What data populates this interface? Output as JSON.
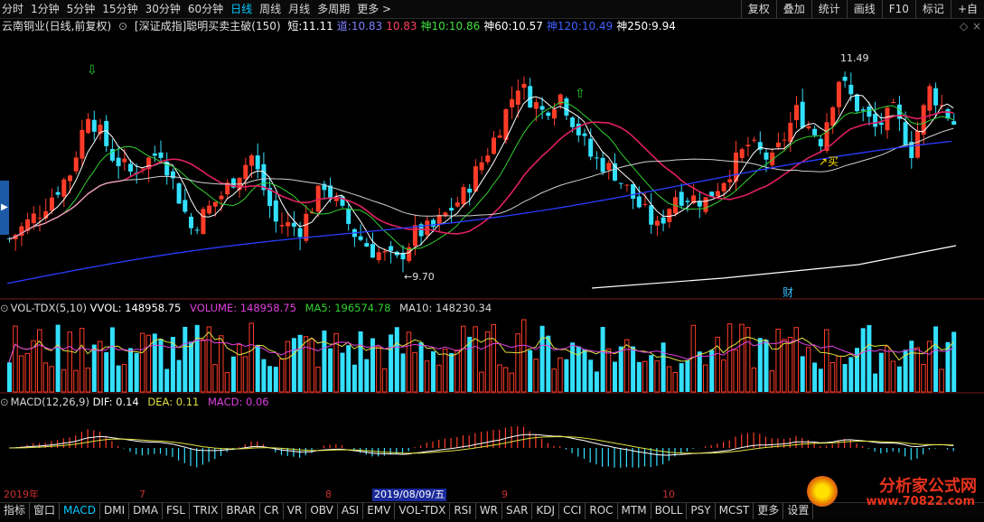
{
  "toolbar": {
    "periods": [
      "分时",
      "1分钟",
      "5分钟",
      "15分钟",
      "30分钟",
      "60分钟",
      "日线",
      "周线",
      "月线",
      "多周期",
      "更多 >"
    ],
    "active_period": "日线",
    "right_buttons": [
      "复权",
      "叠加",
      "统计",
      "画线",
      "F10",
      "标记",
      "+自"
    ]
  },
  "info": {
    "stock": "云南铜业(日线,前复权)",
    "indicator": "[深证成指]聪明买卖主破(150)",
    "items": [
      {
        "label": "短:",
        "value": "11.11",
        "color": "#ffffff"
      },
      {
        "label": "道:",
        "value": "10.83",
        "color": "#8080ff"
      },
      {
        "label": "",
        "value": "10.83",
        "color": "#ff4060"
      },
      {
        "label": "神10:",
        "value": "10.86",
        "color": "#40e040"
      },
      {
        "label": "神60:",
        "value": "10.57",
        "color": "#ffffff"
      },
      {
        "label": "神120:",
        "value": "10.49",
        "color": "#4060ff"
      },
      {
        "label": "神250:",
        "value": "9.94",
        "color": "#ffffff"
      }
    ]
  },
  "annotations": {
    "high": "11.49",
    "low": "9.70",
    "buy": "买",
    "cai": "财"
  },
  "vol": {
    "name": "VOL-TDX(5,10)",
    "vvol": "VVOL: 148958.75",
    "volume": "VOLUME: 148958.75",
    "ma5": "MA5: 196574.78",
    "ma10": "MA10: 148230.34"
  },
  "macd": {
    "name": "MACD(12,26,9)",
    "dif": "DIF: 0.14",
    "dea": "DEA: 0.11",
    "macd": "MACD: 0.06"
  },
  "dates": {
    "year": "2019年",
    "m7": "7",
    "m8": "8",
    "selected": "2019/08/09/五",
    "m9": "9",
    "m10": "10"
  },
  "tabs": [
    "指标",
    "窗口",
    "MACD",
    "DMI",
    "DMA",
    "FSL",
    "TRIX",
    "BRAR",
    "CR",
    "VR",
    "OBV",
    "ASI",
    "EMV",
    "VOL-TDX",
    "RSI",
    "WR",
    "SAR",
    "KDJ",
    "CCI",
    "ROC",
    "MTM",
    "BOLL",
    "PSY",
    "MCST",
    "更多",
    "设置"
  ],
  "active_tab": "MACD",
  "watermark": {
    "name": "分析家公式网",
    "url": "www.70822.com"
  },
  "colors": {
    "up": "#ff3c28",
    "down": "#33e0ff",
    "ma_white": "#ffffff",
    "ma_blue": "#2a3cff",
    "ma_green": "#30d030",
    "ma_magenta": "#e020e0",
    "ma_yellow": "#e0e040"
  }
}
